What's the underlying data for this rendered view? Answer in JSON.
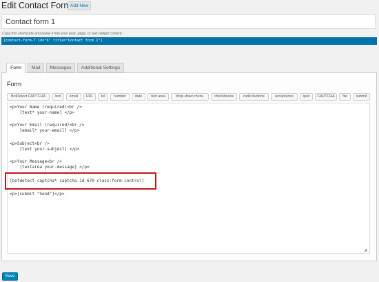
{
  "header": {
    "title": "Edit Contact Form",
    "add_new": "Add New"
  },
  "form_title": "Contact form 1",
  "shortcode_hint": "Copy this shortcode and paste it into your post, page, or text widget content:",
  "shortcode": "[contact-form-7 id=\"6\" title=\"Contact form 1\"]",
  "tabs": [
    {
      "label": "Form",
      "active": true
    },
    {
      "label": "Mail",
      "active": false
    },
    {
      "label": "Messages",
      "active": false
    },
    {
      "label": "Additional Settings",
      "active": false
    }
  ],
  "panel_title": "Form",
  "tag_buttons": [
    "BotDetect CAPTCHA",
    "text",
    "email",
    "URL",
    "tel",
    "number",
    "date",
    "text area",
    "drop-down menu",
    "checkboxes",
    "radio buttons",
    "acceptance",
    "quiz",
    "CAPTCHA",
    "file",
    "submit"
  ],
  "code_lines": [
    "<p>Your Name (required)<br />",
    "    [text* your-name] </p>",
    "",
    "<p>Your Email (required)<br />",
    "    [email* your-email] </p>",
    "",
    "<p>Subject<br />",
    "    [text your-subject] </p>",
    "",
    "<p>Your Message<br />",
    "    [textarea your-message] </p>",
    "",
    "[botdetect_captcha* captcha-id-670 class:form-control]",
    "",
    "<p>[submit \"Send\"]</p>"
  ],
  "save_label": "Save",
  "colors": {
    "accent": "#0073aa",
    "highlight": "#c4141a"
  }
}
